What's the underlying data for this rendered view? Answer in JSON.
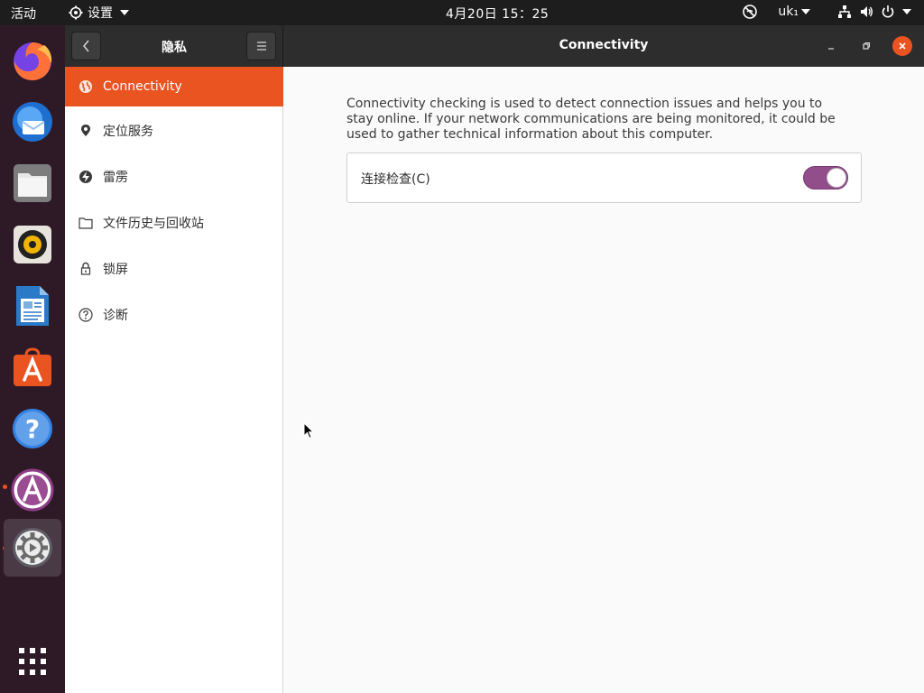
{
  "topbar": {
    "activities": "活动",
    "app_menu": "设置",
    "clock": "4月20日  15：25",
    "keyboard_layout": "uk₁"
  },
  "dock": {
    "items": [
      {
        "icon": "firefox-icon"
      },
      {
        "icon": "thunderbird-icon"
      },
      {
        "icon": "files-icon"
      },
      {
        "icon": "rhythmbox-icon"
      },
      {
        "icon": "libreoffice-writer-icon"
      },
      {
        "icon": "software-center-icon"
      },
      {
        "icon": "help-icon"
      },
      {
        "icon": "app-store-icon"
      },
      {
        "icon": "settings-icon"
      }
    ],
    "show_apps_icon": "app-grid-icon"
  },
  "window": {
    "sidebar_title": "隐私",
    "title": "Connectivity"
  },
  "sidebar": {
    "items": [
      {
        "label": "Connectivity",
        "icon": "globe-icon",
        "selected": true
      },
      {
        "label": "定位服务",
        "icon": "location-pin-icon"
      },
      {
        "label": "雷雳",
        "icon": "thunderbolt-icon"
      },
      {
        "label": "文件历史与回收站",
        "icon": "folder-icon"
      },
      {
        "label": "锁屏",
        "icon": "lock-icon"
      },
      {
        "label": "诊断",
        "icon": "help-circle-icon"
      }
    ]
  },
  "content": {
    "description": "Connectivity checking is used to detect connection issues and helps you to stay online. If your network communications are being monitored, it could be used to gather technical information about this computer.",
    "toggle_label": "连接检查(C)",
    "toggle_on": true
  },
  "colors": {
    "accent": "#e95420",
    "switch_on": "#924d8b"
  }
}
